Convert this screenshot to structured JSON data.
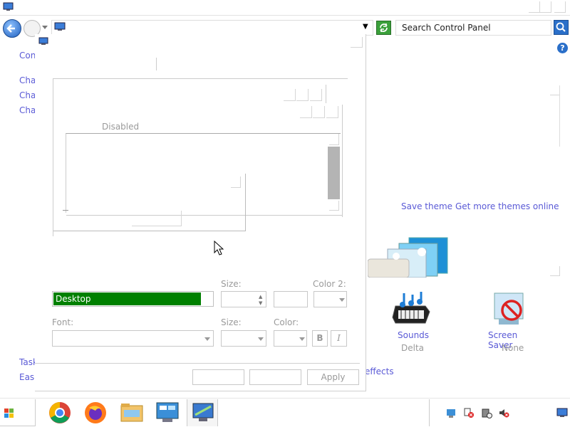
{
  "explorer": {
    "address_dropdown": "▼",
    "search_placeholder": "Search Control Panel",
    "help": "?",
    "sidebar": [
      "Cont",
      "Char",
      "Char",
      "Char"
    ],
    "sidebar_bottom": [
      "Task",
      "Ease"
    ],
    "links": {
      "save_theme": "Save theme",
      "more_themes": "Get more themes online"
    },
    "items": [
      {
        "label": "Sounds",
        "sub": "Delta"
      },
      {
        "label": "Screen Saver",
        "sub": "None"
      }
    ],
    "effects_text": "effects"
  },
  "dialog": {
    "preview_label": "Disabled",
    "item_label": "",
    "item_value": "Desktop",
    "size_label": "Size:",
    "color2_label": "Color 2:",
    "font_label": "Font:",
    "font_size_label": "Size:",
    "color_label": "Color:",
    "bold": "B",
    "italic": "I",
    "apply": "Apply"
  },
  "colors": {
    "item_selected": "#008000",
    "link": "#5a5ad6",
    "search_btn": "#2a6fc9",
    "refresh_btn": "#3aa03a"
  }
}
